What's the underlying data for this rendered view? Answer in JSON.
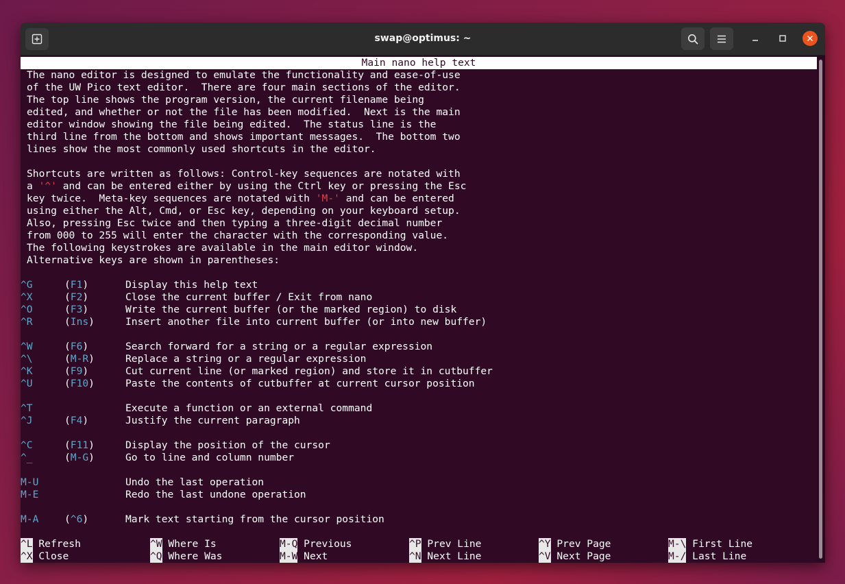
{
  "window": {
    "title": "swap@optimus: ~"
  },
  "colors": {
    "terminal_bg": "#300a24",
    "key_color": "#5fa6c9",
    "highlight_red": "#d9424a",
    "close_button": "#e95420"
  },
  "icons": {
    "new_tab": "plus-in-box",
    "search": "magnifier",
    "menu": "hamburger",
    "minimize": "dash",
    "maximize": "square",
    "close": "x"
  },
  "nano": {
    "header": "Main nano help text",
    "intro": [
      "The nano editor is designed to emulate the functionality and ease-of-use",
      "of the UW Pico text editor.  There are four main sections of the editor.",
      "The top line shows the program version, the current filename being",
      "edited, and whether or not the file has been modified.  Next is the main",
      "editor window showing the file being edited.  The status line is the",
      "third line from the bottom and shows important messages.  The bottom two",
      "lines show the most commonly used shortcuts in the editor."
    ],
    "shortcuts_para": {
      "l1": "Shortcuts are written as follows: Control-key sequences are notated with",
      "l2_a": "a ",
      "l2_hl": "'^'",
      "l2_b": " and can be entered either by using the Ctrl key or pressing the Esc",
      "l3_a": "key twice.  Meta-key sequences are notated with ",
      "l3_hl": "'M-'",
      "l3_b": " and can be entered",
      "l4": "using either the Alt, Cmd, or Esc key, depending on your keyboard setup.",
      "l5": "Also, pressing Esc twice and then typing a three-digit decimal number",
      "l6": "from 000 to 255 will enter the character with the corresponding value.",
      "l7": "The following keystrokes are available in the main editor window.",
      "l8": "Alternative keys are shown in parentheses:"
    },
    "keys": [
      {
        "key": "^G",
        "alt": "F1",
        "desc": "Display this help text"
      },
      {
        "key": "^X",
        "alt": "F2",
        "desc": "Close the current buffer / Exit from nano"
      },
      {
        "key": "^O",
        "alt": "F3",
        "desc": "Write the current buffer (or the marked region) to disk"
      },
      {
        "key": "^R",
        "alt": "Ins",
        "desc": "Insert another file into current buffer (or into new buffer)"
      },
      {
        "key": "^W",
        "alt": "F6",
        "desc": "Search forward for a string or a regular expression"
      },
      {
        "key": "^\\",
        "alt": "M-R",
        "desc": "Replace a string or a regular expression"
      },
      {
        "key": "^K",
        "alt": "F9",
        "desc": "Cut current line (or marked region) and store it in cutbuffer"
      },
      {
        "key": "^U",
        "alt": "F10",
        "desc": "Paste the contents of cutbuffer at current cursor position"
      },
      {
        "key": "^T",
        "alt": "",
        "desc": "Execute a function or an external command"
      },
      {
        "key": "^J",
        "alt": "F4",
        "desc": "Justify the current paragraph"
      },
      {
        "key": "^C",
        "alt": "F11",
        "desc": "Display the position of the cursor"
      },
      {
        "key": "^_",
        "alt": "M-G",
        "desc": "Go to line and column number"
      },
      {
        "key": "M-U",
        "alt": "",
        "desc": "Undo the last operation"
      },
      {
        "key": "M-E",
        "alt": "",
        "desc": "Redo the last undone operation"
      },
      {
        "key": "M-A",
        "alt": "^6",
        "desc": "Mark text starting from the cursor position"
      }
    ],
    "bottom_bar": [
      [
        {
          "key": "^L",
          "label": "Refresh"
        },
        {
          "key": "^W",
          "label": "Where Is"
        },
        {
          "key": "M-Q",
          "label": "Previous"
        },
        {
          "key": "^P",
          "label": "Prev Line"
        },
        {
          "key": "^Y",
          "label": "Prev Page"
        },
        {
          "key": "M-\\",
          "label": "First Line"
        }
      ],
      [
        {
          "key": "^X",
          "label": "Close"
        },
        {
          "key": "^Q",
          "label": "Where Was"
        },
        {
          "key": "M-W",
          "label": "Next"
        },
        {
          "key": "^N",
          "label": "Next Line"
        },
        {
          "key": "^V",
          "label": "Next Page"
        },
        {
          "key": "M-/",
          "label": "Last Line"
        }
      ]
    ]
  }
}
